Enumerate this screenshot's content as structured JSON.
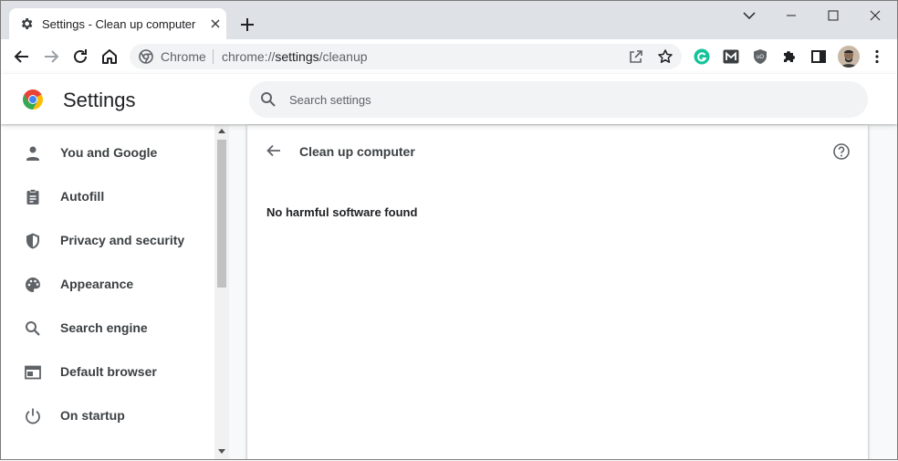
{
  "tab": {
    "title": "Settings - Clean up computer"
  },
  "omnibox": {
    "site_label": "Chrome",
    "url_scheme": "chrome://",
    "url_host": "settings",
    "url_path": "/cleanup"
  },
  "header": {
    "title": "Settings",
    "search_placeholder": "Search settings"
  },
  "sidebar": {
    "items": [
      {
        "label": "You and Google",
        "icon": "person-icon"
      },
      {
        "label": "Autofill",
        "icon": "clipboard-icon"
      },
      {
        "label": "Privacy and security",
        "icon": "shield-icon"
      },
      {
        "label": "Appearance",
        "icon": "palette-icon"
      },
      {
        "label": "Search engine",
        "icon": "magnifier-icon"
      },
      {
        "label": "Default browser",
        "icon": "browser-window-icon"
      },
      {
        "label": "On startup",
        "icon": "power-icon"
      }
    ]
  },
  "page": {
    "title": "Clean up computer",
    "status": "No harmful software found"
  },
  "colors": {
    "tabstrip": "#dee1e6",
    "omnibox": "#f1f3f4",
    "text": "#3c4043",
    "icon": "#5f6368"
  }
}
